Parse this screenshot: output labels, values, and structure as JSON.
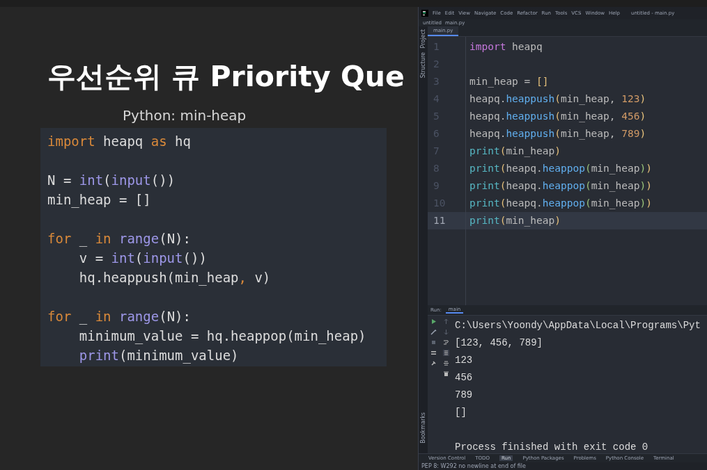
{
  "slide": {
    "title": "우선순위 큐 Priority Que",
    "subtitle": "Python: min-heap",
    "code": [
      {
        "gap_before": false,
        "indented": false,
        "tokens": [
          {
            "text": "import",
            "kind": "keyword"
          },
          {
            "text": " heapq ",
            "kind": "plain"
          },
          {
            "text": "as",
            "kind": "keyword"
          },
          {
            "text": " hq",
            "kind": "plain"
          }
        ]
      },
      {
        "gap_before": true,
        "indented": false,
        "tokens": [
          {
            "text": "N = ",
            "kind": "plain"
          },
          {
            "text": "int",
            "kind": "builtin"
          },
          {
            "text": "(",
            "kind": "plain"
          },
          {
            "text": "input",
            "kind": "builtin"
          },
          {
            "text": "())",
            "kind": "plain"
          }
        ]
      },
      {
        "gap_before": false,
        "indented": false,
        "tokens": [
          {
            "text": "min_heap = []",
            "kind": "plain"
          }
        ]
      },
      {
        "gap_before": true,
        "indented": false,
        "tokens": [
          {
            "text": "for",
            "kind": "keyword"
          },
          {
            "text": " _ ",
            "kind": "plain"
          },
          {
            "text": "in",
            "kind": "keyword"
          },
          {
            "text": " range",
            "kind": "builtin"
          },
          {
            "text": "(N):",
            "kind": "plain"
          }
        ]
      },
      {
        "gap_before": false,
        "indented": true,
        "tokens": [
          {
            "text": "v = ",
            "kind": "plain"
          },
          {
            "text": "int",
            "kind": "builtin"
          },
          {
            "text": "(",
            "kind": "plain"
          },
          {
            "text": "input",
            "kind": "builtin"
          },
          {
            "text": "())",
            "kind": "plain"
          }
        ]
      },
      {
        "gap_before": false,
        "indented": true,
        "tokens": [
          {
            "text": "hq.heappush(min_heap",
            "kind": "plain"
          },
          {
            "text": ",",
            "kind": "keyword"
          },
          {
            "text": " v)",
            "kind": "plain"
          }
        ]
      },
      {
        "gap_before": true,
        "indented": false,
        "tokens": [
          {
            "text": "for",
            "kind": "keyword"
          },
          {
            "text": " _ ",
            "kind": "plain"
          },
          {
            "text": "in",
            "kind": "keyword"
          },
          {
            "text": " range",
            "kind": "builtin"
          },
          {
            "text": "(N):",
            "kind": "plain"
          }
        ]
      },
      {
        "gap_before": false,
        "indented": true,
        "tokens": [
          {
            "text": "minimum_value = hq.heappop(min_heap)",
            "kind": "plain"
          }
        ]
      },
      {
        "gap_before": false,
        "indented": true,
        "tokens": [
          {
            "text": "print",
            "kind": "builtin"
          },
          {
            "text": "(minimum_value)",
            "kind": "plain"
          }
        ]
      }
    ]
  },
  "ide": {
    "menu": [
      "File",
      "Edit",
      "View",
      "Navigate",
      "Code",
      "Refactor",
      "Run",
      "Tools",
      "VCS",
      "Window",
      "Help"
    ],
    "window_title": "untitled - main.py",
    "breadcrumb": [
      "untitled",
      "main.py"
    ],
    "tabs": [
      {
        "label": "main.py",
        "selected": true
      }
    ],
    "left_tools": [
      "Project",
      "Structure"
    ],
    "bottom_left_tool": "Bookmarks",
    "editor": [
      {
        "number": "1",
        "current": false,
        "tokens": [
          {
            "text": "import",
            "kind": "keyword"
          },
          {
            "text": " heapq",
            "kind": "plain"
          }
        ]
      },
      {
        "number": "2",
        "current": false
      },
      {
        "number": "3",
        "current": false,
        "tokens": [
          {
            "text": "min_heap = ",
            "kind": "plain"
          },
          {
            "text": "[]",
            "kind": "paren"
          }
        ]
      },
      {
        "number": "4",
        "current": false,
        "tokens": [
          {
            "text": "heapq.",
            "kind": "plain"
          },
          {
            "text": "heappush",
            "kind": "func"
          },
          {
            "text": "(",
            "kind": "paren"
          },
          {
            "text": "min_heap, ",
            "kind": "plain"
          },
          {
            "text": "123",
            "kind": "number"
          },
          {
            "text": ")",
            "kind": "paren"
          }
        ]
      },
      {
        "number": "5",
        "current": false,
        "tokens": [
          {
            "text": "heapq.",
            "kind": "plain"
          },
          {
            "text": "heappush",
            "kind": "func"
          },
          {
            "text": "(",
            "kind": "paren"
          },
          {
            "text": "min_heap, ",
            "kind": "plain"
          },
          {
            "text": "456",
            "kind": "number"
          },
          {
            "text": ")",
            "kind": "paren"
          }
        ]
      },
      {
        "number": "6",
        "current": false,
        "tokens": [
          {
            "text": "heapq.",
            "kind": "plain"
          },
          {
            "text": "heappush",
            "kind": "func"
          },
          {
            "text": "(",
            "kind": "paren"
          },
          {
            "text": "min_heap, ",
            "kind": "plain"
          },
          {
            "text": "789",
            "kind": "number"
          },
          {
            "text": ")",
            "kind": "paren"
          }
        ]
      },
      {
        "number": "7",
        "current": false,
        "tokens": [
          {
            "text": "print",
            "kind": "builtin"
          },
          {
            "text": "(",
            "kind": "paren"
          },
          {
            "text": "min_heap",
            "kind": "plain"
          },
          {
            "text": ")",
            "kind": "paren"
          }
        ]
      },
      {
        "number": "8",
        "current": false,
        "tokens": [
          {
            "text": "print",
            "kind": "builtin"
          },
          {
            "text": "(",
            "kind": "paren"
          },
          {
            "text": "heapq.",
            "kind": "plain"
          },
          {
            "text": "heappop",
            "kind": "func"
          },
          {
            "text": "(",
            "kind": "paren2"
          },
          {
            "text": "min_heap",
            "kind": "plain"
          },
          {
            "text": ")",
            "kind": "paren2"
          },
          {
            "text": ")",
            "kind": "paren"
          }
        ]
      },
      {
        "number": "9",
        "current": false,
        "tokens": [
          {
            "text": "print",
            "kind": "builtin"
          },
          {
            "text": "(",
            "kind": "paren"
          },
          {
            "text": "heapq.",
            "kind": "plain"
          },
          {
            "text": "heappop",
            "kind": "func"
          },
          {
            "text": "(",
            "kind": "paren2"
          },
          {
            "text": "min_heap",
            "kind": "plain"
          },
          {
            "text": ")",
            "kind": "paren2"
          },
          {
            "text": ")",
            "kind": "paren"
          }
        ]
      },
      {
        "number": "10",
        "current": false,
        "tokens": [
          {
            "text": "print",
            "kind": "builtin"
          },
          {
            "text": "(",
            "kind": "paren"
          },
          {
            "text": "heapq.",
            "kind": "plain"
          },
          {
            "text": "heappop",
            "kind": "func"
          },
          {
            "text": "(",
            "kind": "paren2"
          },
          {
            "text": "min_heap",
            "kind": "plain"
          },
          {
            "text": ")",
            "kind": "paren2"
          },
          {
            "text": ")",
            "kind": "paren"
          }
        ]
      },
      {
        "number": "11",
        "current": true,
        "tokens": [
          {
            "text": "print",
            "kind": "builtin"
          },
          {
            "text": "(",
            "kind": "paren"
          },
          {
            "text": "min_heap",
            "kind": "plain"
          },
          {
            "text": ")",
            "kind": "paren"
          }
        ]
      }
    ],
    "run": {
      "label": "Run:",
      "tab": "main",
      "output": [
        "C:\\Users\\Yoondy\\AppData\\Local\\Programs\\Pyt",
        "[123, 456, 789]",
        "123",
        "456",
        "789",
        "[]"
      ],
      "exit_message": "Process finished with exit code 0"
    },
    "bottom_tabs": [
      {
        "label": "Version Control",
        "selected": false
      },
      {
        "label": "TODO",
        "selected": false
      },
      {
        "label": "Run",
        "selected": true
      },
      {
        "label": "Python Packages",
        "selected": false
      },
      {
        "label": "Problems",
        "selected": false
      },
      {
        "label": "Python Console",
        "selected": false
      },
      {
        "label": "Terminal",
        "selected": false
      }
    ],
    "status": "PEP 8: W292 no newline at end of file"
  }
}
